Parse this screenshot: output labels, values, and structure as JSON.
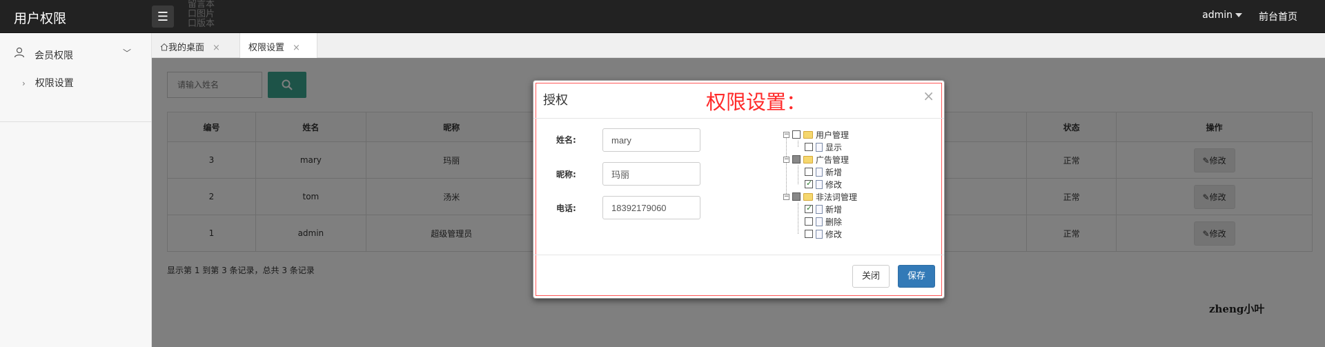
{
  "header": {
    "brand": "用户权限",
    "ghost_items": [
      "留言本",
      "口图片",
      "口版本"
    ],
    "user": "admin",
    "home_link": "前台首页"
  },
  "sidebar": {
    "group_label": "会员权限",
    "sub_item": "权限设置"
  },
  "tabs": [
    {
      "label": "我的桌面"
    },
    {
      "label": "权限设置"
    }
  ],
  "search": {
    "placeholder": "请输入姓名"
  },
  "table": {
    "headers": [
      "编号",
      "姓名",
      "昵称",
      "",
      "状态",
      "操作"
    ],
    "rows": [
      {
        "id": "3",
        "name": "mary",
        "nick": "玛丽",
        "status": "正常",
        "action": "修改"
      },
      {
        "id": "2",
        "name": "tom",
        "nick": "汤米",
        "status": "正常",
        "action": "修改"
      },
      {
        "id": "1",
        "name": "admin",
        "nick": "超级管理员",
        "status": "正常",
        "action": "修改"
      }
    ]
  },
  "pager_text": "显示第 1 到第 3 条记录，总共 3 条记录",
  "modal": {
    "title": "授权",
    "annotation": "权限设置：",
    "close_symbol": "×",
    "fields": [
      {
        "label": "姓名:",
        "value": "mary"
      },
      {
        "label": "昵称:",
        "value": "玛丽"
      },
      {
        "label": "电话:",
        "value": "18392179060"
      }
    ],
    "tree": [
      {
        "label": "用户管理",
        "level": 0,
        "state": "unchecked"
      },
      {
        "label": "显示",
        "level": 1,
        "state": "unchecked"
      },
      {
        "label": "广告管理",
        "level": 0,
        "state": "partial"
      },
      {
        "label": "新增",
        "level": 1,
        "state": "unchecked"
      },
      {
        "label": "修改",
        "level": 1,
        "state": "checked"
      },
      {
        "label": "非法词管理",
        "level": 0,
        "state": "partial"
      },
      {
        "label": "新增",
        "level": 1,
        "state": "checked"
      },
      {
        "label": "删除",
        "level": 1,
        "state": "unchecked"
      },
      {
        "label": "修改",
        "level": 1,
        "state": "unchecked"
      }
    ],
    "close_button": "关闭",
    "save_button": "保存"
  },
  "watermark": "zheng小叶",
  "colors": {
    "topbar": "#222222",
    "primary": "#337ab7",
    "search_button": "#3aa690",
    "annotation_red": "#ff2a2a",
    "status_green": "#2e8b2e"
  }
}
